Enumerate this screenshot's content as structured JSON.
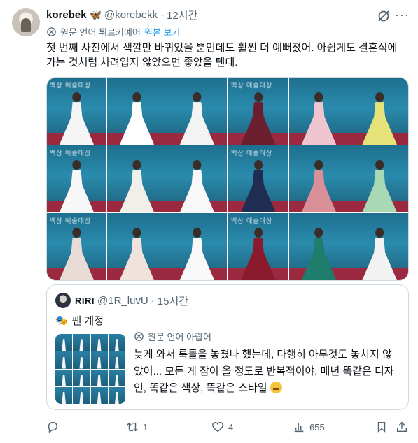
{
  "author": {
    "name": "korebek",
    "badge_emoji": "🦋",
    "handle": "@korebekk",
    "dot": "·",
    "time": "12시간"
  },
  "translate": {
    "label": "원문 언어 튀르키예어",
    "link": "원본 보기"
  },
  "tweet_text": "첫 번째 사진에서 색깔만 바뀌었을 뿐인데도 훨씬 더 예뻐졌어. 아쉽게도 결혼식에 가는 것처럼 차려입지 않았으면 좋았을 텐데.",
  "media": {
    "watermark": "백상 예술대상",
    "left_dresses": [
      "#f5f5f5",
      "#ffffff",
      "#f3f3f3",
      "#f7f7f7",
      "#f1efe9",
      "#f8f8f8",
      "#e9dcd6",
      "#efe3dc",
      "#f9f9f9"
    ],
    "right_dresses": [
      "#6b1f2e",
      "#efc6cf",
      "#e6e27a",
      "#1f2d52",
      "#d88f97",
      "#a9d9b4",
      "#8b1b2c",
      "#1f7d6b",
      "#f2f2f2"
    ]
  },
  "quote": {
    "name": "RIRI",
    "handle": "@1R_luvU",
    "dot": "·",
    "time": "15시간",
    "label": "팬 계정",
    "translate_label": "원문 언어 아랍어",
    "text": "늦게 와서 룩들을 놓쳤나 했는데, 다행히 아무것도 놓치지 않았어... 모든 게 잠이 올 정도로 반복적이야, 매년 똑같은 디자인, 똑같은 색상, 똑같은 스타일"
  },
  "actions": {
    "retweet_count": "1",
    "like_count": "4",
    "view_count": "655"
  },
  "colors": {
    "link": "#1d9bf0",
    "muted": "#536471",
    "border": "#cfd9de"
  }
}
